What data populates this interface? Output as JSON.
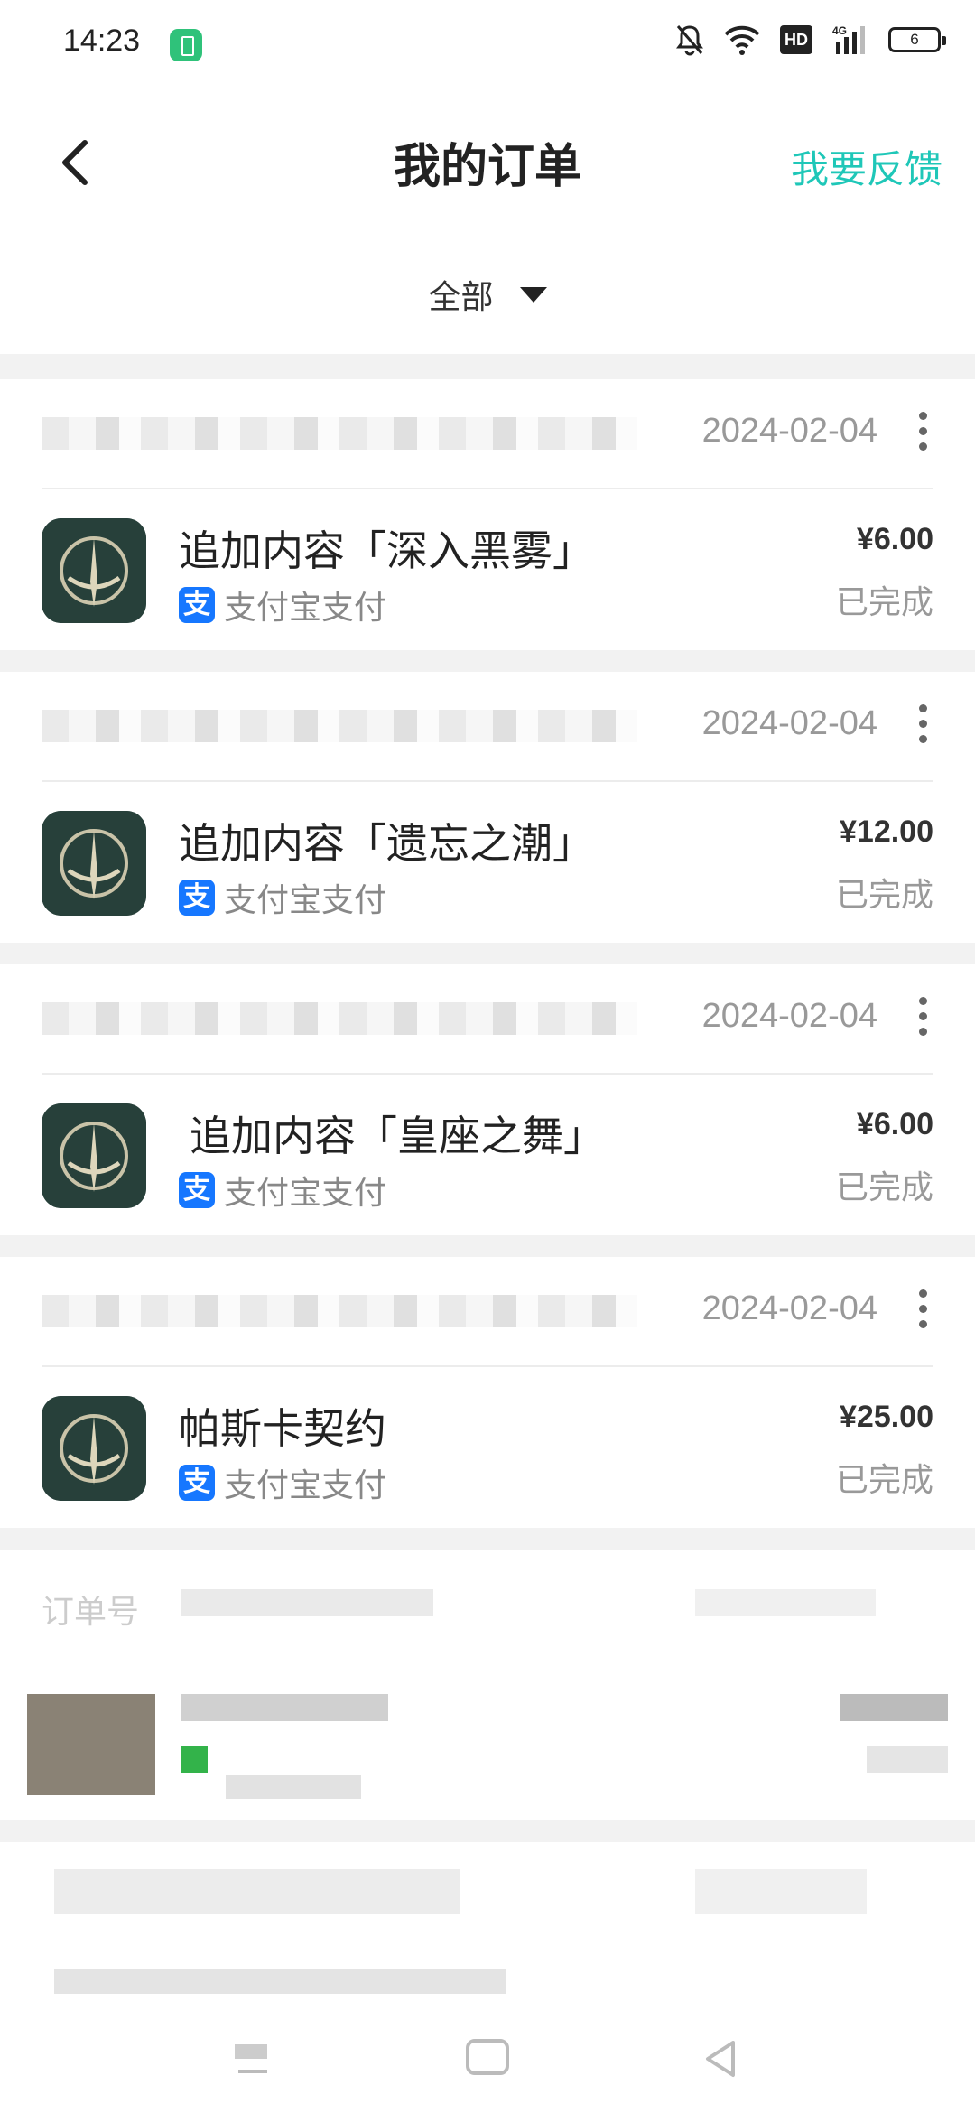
{
  "status_bar": {
    "time": "14:23",
    "battery": "6",
    "hd": "HD",
    "net": "4G"
  },
  "header": {
    "title": "我的订单",
    "feedback": "我要反馈"
  },
  "filter": {
    "label": "全部"
  },
  "orders": [
    {
      "date": "2024-02-04",
      "name": "追加内容「深入黑雾」",
      "payment": "支付宝支付",
      "price": "¥6.00",
      "status": "已完成"
    },
    {
      "date": "2024-02-04",
      "name": "追加内容「遗忘之潮」",
      "payment": "支付宝支付",
      "price": "¥12.00",
      "status": "已完成"
    },
    {
      "date": "2024-02-04",
      "name": "追加内容「皇座之舞」",
      "payment": "支付宝支付",
      "price": "¥6.00",
      "status": "已完成"
    },
    {
      "date": "2024-02-04",
      "name": "帕斯卡契约",
      "payment": "支付宝支付",
      "price": "¥25.00",
      "status": "已完成"
    }
  ],
  "blurred_order": {
    "label": "订单号"
  },
  "colors": {
    "accent": "#1fc7b8",
    "alipay": "#1677ff",
    "divider": "#f2f2f2"
  },
  "icons": {
    "back": "back-arrow-icon",
    "more": "more-vertical-icon",
    "filter": "dropdown-triangle-icon",
    "alipay": "alipay-icon"
  }
}
